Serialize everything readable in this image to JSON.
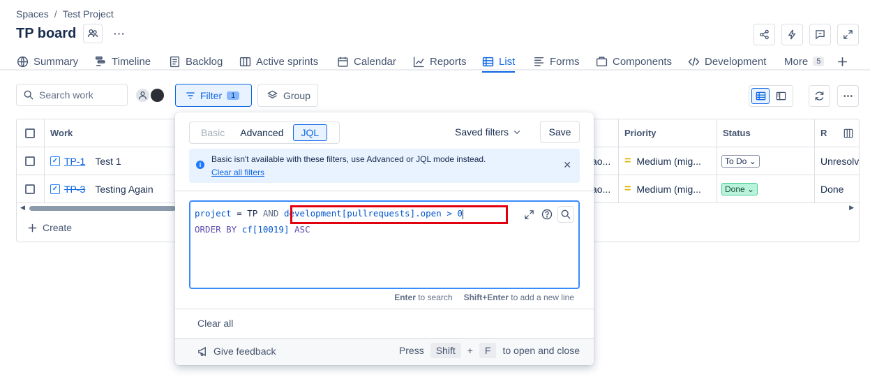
{
  "breadcrumb": {
    "space": "Spaces",
    "separator": "/",
    "project": "Test Project"
  },
  "header": {
    "title": "TP board",
    "more": "···"
  },
  "tabs": [
    {
      "label": "Summary",
      "icon": "globe-icon"
    },
    {
      "label": "Timeline",
      "icon": "timeline-icon"
    },
    {
      "label": "Backlog",
      "icon": "backlog-icon"
    },
    {
      "label": "Active sprints",
      "icon": "board-icon"
    },
    {
      "label": "Calendar",
      "icon": "calendar-icon"
    },
    {
      "label": "Reports",
      "icon": "chart-icon"
    },
    {
      "label": "List",
      "icon": "list-icon",
      "active": true
    },
    {
      "label": "Forms",
      "icon": "forms-icon"
    },
    {
      "label": "Components",
      "icon": "components-icon"
    },
    {
      "label": "Development",
      "icon": "code-icon"
    },
    {
      "label": "More",
      "count": "5"
    }
  ],
  "toolbar": {
    "search_placeholder": "Search work",
    "filter_label": "Filter",
    "filter_count": "1",
    "group_label": "Group"
  },
  "table": {
    "columns": {
      "work": "Work",
      "priority": "Priority",
      "status": "Status",
      "resolution": "R"
    },
    "rows": [
      {
        "key": "TP-1",
        "summary": "Test 1",
        "assignee_trunc": "ao...",
        "priority": "Medium (mig...",
        "status": "To Do",
        "resolution": "Unresolv"
      },
      {
        "key": "TP-3",
        "summary": "Testing Again",
        "assignee_trunc": "ao...",
        "priority": "Medium (mig...",
        "status": "Done",
        "resolution": "Done"
      }
    ],
    "create_label": "Create"
  },
  "filter_popup": {
    "modes": {
      "basic": "Basic",
      "advanced": "Advanced",
      "jql": "JQL"
    },
    "saved_filters": "Saved filters",
    "save": "Save",
    "info_text": "Basic isn't available with these filters, use Advanced or JQL mode instead.",
    "info_link": "Clear all filters",
    "jql": {
      "line1_field": "project",
      "line1_op": " = ",
      "line1_value": "TP",
      "line1_and": " AND ",
      "line1_clause": "development[pullrequests].open > 0",
      "line2_order": "ORDER BY",
      "line2_field": " cf[10019] ",
      "line2_dir": "ASC"
    },
    "hint_enter_key": "Enter",
    "hint_enter": " to search",
    "hint_shift_key": "Shift+Enter",
    "hint_shift": " to add a new line",
    "clear_all": "Clear all",
    "feedback": "Give feedback",
    "shortcut_press": "Press",
    "shortcut_key1": "Shift",
    "shortcut_plus": "+",
    "shortcut_key2": "F",
    "shortcut_suffix": "to open and close"
  },
  "colors": {
    "accent": "#0c66e4",
    "highlight": "#e2000f",
    "info_bg": "#e9f2ff"
  }
}
